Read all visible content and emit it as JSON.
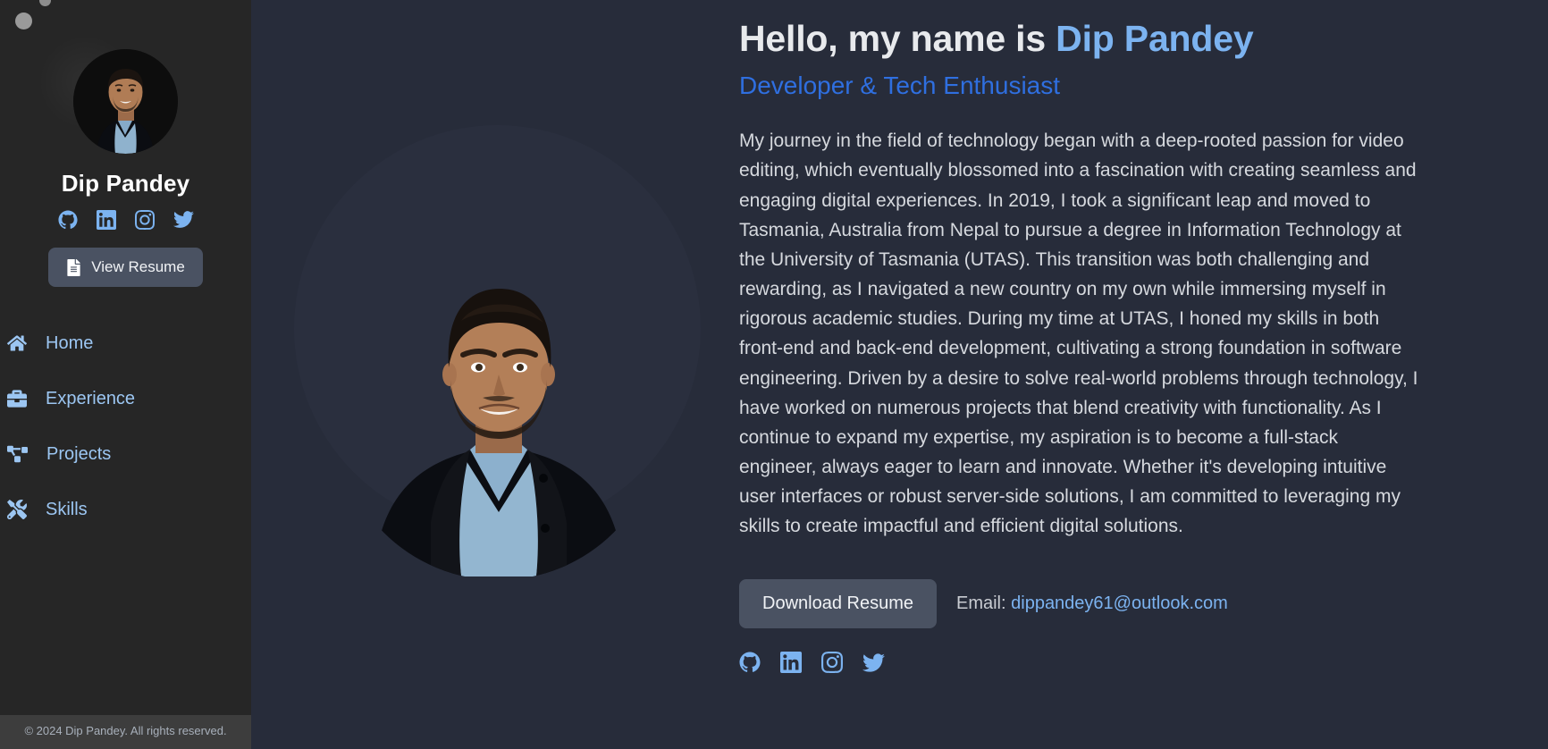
{
  "sidebar": {
    "name": "Dip Pandey",
    "resume_button": "View Resume",
    "resume_icon": "file-document-icon",
    "socials": [
      {
        "name": "github",
        "label": "GitHub"
      },
      {
        "name": "linkedin",
        "label": "LinkedIn"
      },
      {
        "name": "instagram",
        "label": "Instagram"
      },
      {
        "name": "twitter",
        "label": "Twitter"
      }
    ],
    "nav": [
      {
        "label": "Home",
        "icon": "home-icon"
      },
      {
        "label": "Experience",
        "icon": "briefcase-icon"
      },
      {
        "label": "Projects",
        "icon": "project-diagram-icon"
      },
      {
        "label": "Skills",
        "icon": "tools-icon"
      }
    ],
    "footer": "© 2024 Dip Pandey. All rights reserved."
  },
  "hero": {
    "headline_prefix": "Hello, my name is ",
    "headline_name": "Dip Pandey",
    "subtitle": "Developer & Tech Enthusiast",
    "bio": "My journey in the field of technology began with a deep-rooted passion for video editing, which eventually blossomed into a fascination with creating seamless and engaging digital experiences. In 2019, I took a significant leap and moved to Tasmania, Australia from Nepal to pursue a degree in Information Technology at the University of Tasmania (UTAS). This transition was both challenging and rewarding, as I navigated a new country on my own while immersing myself in rigorous academic studies. During my time at UTAS, I honed my skills in both front-end and back-end development, cultivating a strong foundation in software engineering. Driven by a desire to solve real-world problems through technology, I have worked on numerous projects that blend creativity with functionality. As I continue to expand my expertise, my aspiration is to become a full-stack engineer, always eager to learn and innovate. Whether it's developing intuitive user interfaces or robust server-side solutions, I am committed to leveraging my skills to create impactful and efficient digital solutions.",
    "download_button": "Download Resume",
    "email_label": "Email:",
    "email_address": "dippandey61@outlook.com",
    "socials": [
      {
        "name": "github",
        "label": "GitHub"
      },
      {
        "name": "linkedin",
        "label": "LinkedIn"
      },
      {
        "name": "instagram",
        "label": "Instagram"
      },
      {
        "name": "twitter",
        "label": "Twitter"
      }
    ]
  },
  "colors": {
    "sidebar_bg": "#262626",
    "main_bg": "#272c3a",
    "accent_light_blue": "#7cb3f0",
    "accent_blue": "#2f6fe0",
    "nav_link": "#9cc6f2",
    "button_bg": "#4a5262",
    "heading_text": "#e8eaed",
    "body_text": "#d6d9de",
    "footer_bg": "#3d3d3d"
  }
}
